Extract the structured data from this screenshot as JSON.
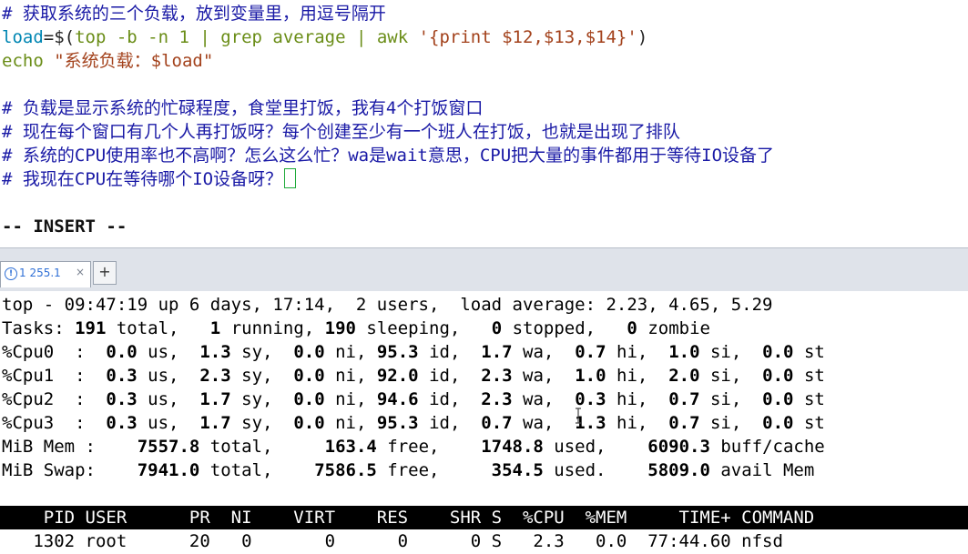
{
  "editor": {
    "comment1": "# 获取系统的三个负载，放到变量里，用逗号隔开",
    "load_var": "load",
    "load_eq": "=$(",
    "load_cmd": "top -b -n 1 | grep average | awk ",
    "load_awk": "'{print $12,$13,$14}'",
    "load_close": ")",
    "echo_kw": "echo",
    "echo_str": " \"系统负载：$load\"",
    "comment2": "# 负载是显示系统的忙碌程度，食堂里打饭，我有4个打饭窗口",
    "comment3": "# 现在每个窗口有几个人再打饭呀？每个创建至少有一个班人在打饭，也就是出现了排队",
    "comment4": "# 系统的CPU使用率也不高啊？怎么这么忙？wa是wait意思，CPU把大量的事件都用于等待IO设备了",
    "comment5": "# 我现在CPU在等待哪个IO设备呀？",
    "mode": "-- INSERT --"
  },
  "tabs": [
    {
      "label": "1 255.1",
      "status_icon": "info-circle-icon"
    }
  ],
  "terminal": {
    "line_top": "top - 09:47:19 up 6 days, 17:14,  2 users,  load average: 2.23, 4.65, 5.29",
    "tasks": {
      "prefix": "Tasks: ",
      "total": "191",
      "total_label": " total,   ",
      "running": "1",
      "running_label": " running, ",
      "sleeping": "190",
      "sleeping_label": " sleeping,   ",
      "stopped": "0",
      "stopped_label": " stopped,   ",
      "zombie": "0",
      "zombie_label": " zombie"
    },
    "cpus": [
      {
        "name": "%Cpu0  : ",
        "us": " 0.0",
        "sy": "  1.3",
        "ni": "  0.0",
        "id": " 95.3",
        "wa": "  1.7",
        "hi": "  0.7",
        "si": "  1.0",
        "st": "  0.0"
      },
      {
        "name": "%Cpu1  : ",
        "us": " 0.3",
        "sy": "  2.3",
        "ni": "  0.0",
        "id": " 92.0",
        "wa": "  2.3",
        "hi": "  1.0",
        "si": "  2.0",
        "st": "  0.0"
      },
      {
        "name": "%Cpu2  : ",
        "us": " 0.3",
        "sy": "  1.7",
        "ni": "  0.0",
        "id": " 94.6",
        "wa": "  2.3",
        "hi": "  0.3",
        "si": "  0.7",
        "st": "  0.0"
      },
      {
        "name": "%Cpu3  : ",
        "us": " 0.3",
        "sy": "  1.7",
        "ni": "  0.0",
        "id": " 95.3",
        "wa": "  0.7",
        "hi": "  1.3",
        "si": "  0.7",
        "st": "  0.0"
      }
    ],
    "mem": {
      "prefix": "MiB Mem :  ",
      "total": "  7557.8",
      "total_label": " total,  ",
      "free": "   163.4",
      "free_label": " free,  ",
      "used": "  1748.8",
      "used_label": " used,  ",
      "cache": "  6090.3",
      "cache_label": " buff/cache"
    },
    "swap": {
      "prefix": "MiB Swap:  ",
      "total": "  7941.0",
      "total_label": " total,  ",
      "free": "  7586.5",
      "free_label": " free,  ",
      "used": "   354.5",
      "used_label": " used.  ",
      "avail": "  5809.0",
      "avail_label": " avail Mem"
    },
    "header": "    PID USER      PR  NI    VIRT    RES    SHR S  %CPU  %MEM     TIME+ COMMAND",
    "row": "   1302 root      20   0       0      0      0 S   2.3   0.0  77:44.60 nfsd"
  }
}
